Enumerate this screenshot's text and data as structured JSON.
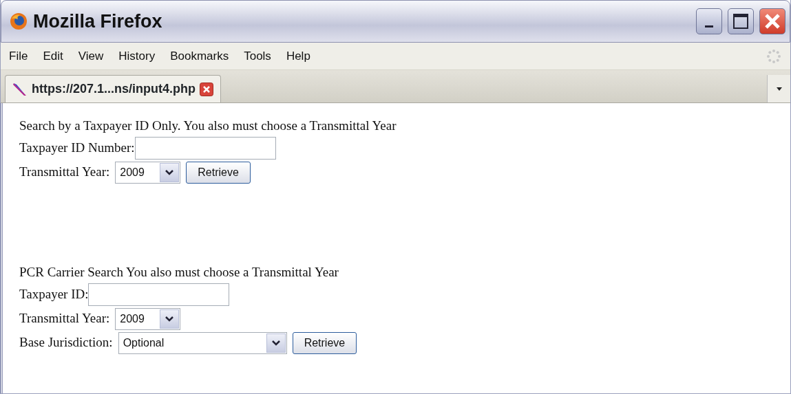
{
  "window": {
    "title": "Mozilla Firefox"
  },
  "menu": [
    "File",
    "Edit",
    "View",
    "History",
    "Bookmarks",
    "Tools",
    "Help"
  ],
  "tabs": [
    {
      "label": "https://207.1...ns/input4.php",
      "selected": true
    }
  ],
  "sections": [
    {
      "heading": "Search by a Taxpayer ID Only. You also must choose a Transmittal Year",
      "rows": [
        {
          "kind": "text",
          "label": "Taxpayer ID Number:"
        },
        {
          "kind": "select",
          "label": "Transmittal Year:",
          "value": "2009",
          "button": "Retrieve"
        }
      ]
    },
    {
      "heading": "PCR Carrier Search You also must choose a Transmittal Year",
      "rows": [
        {
          "kind": "text",
          "label": "Taxpayer ID:"
        },
        {
          "kind": "select",
          "label": "Transmittal Year:",
          "value": "2009"
        },
        {
          "kind": "wide-select",
          "label": "Base Jurisdiction:",
          "value": "Optional",
          "button": "Retrieve"
        }
      ]
    }
  ]
}
